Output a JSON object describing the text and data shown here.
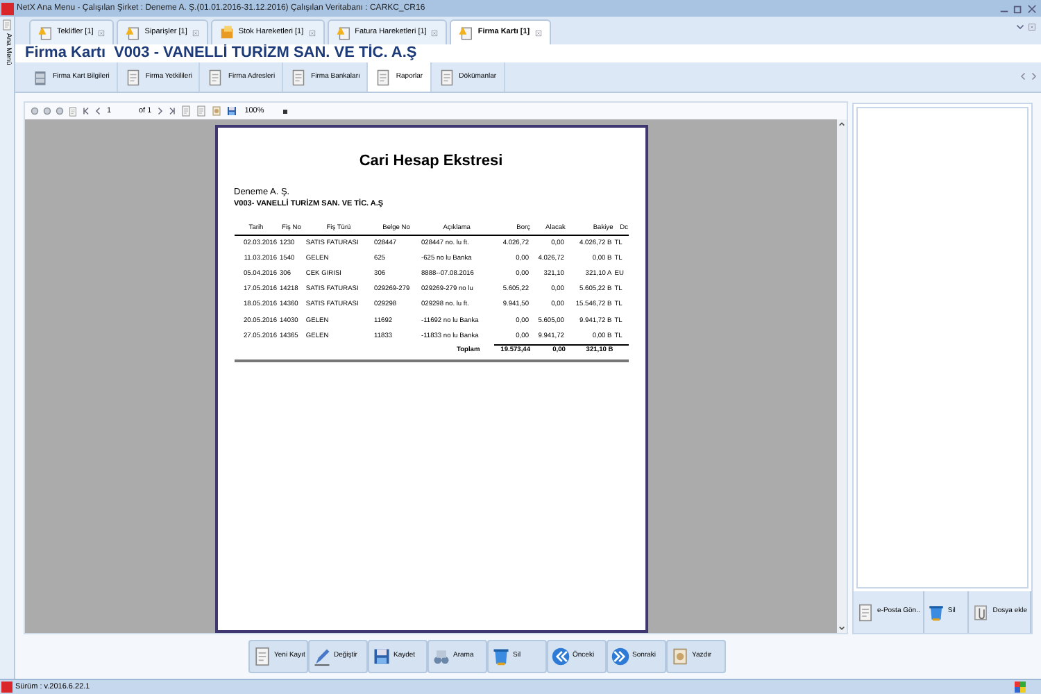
{
  "window": {
    "title": "NetX Ana Menu - Çalışılan Şirket : Deneme A. Ş.(01.01.2016-31.12.2016) Çalışılan Veritabanı : CARKC_CR16"
  },
  "side_menu": {
    "label": "Ana Menü"
  },
  "tabs": [
    {
      "label": "Teklifler [1]",
      "selected": false
    },
    {
      "label": "Siparişler [1]",
      "selected": false
    },
    {
      "label": "Stok Hareketleri [1]",
      "selected": false
    },
    {
      "label": "Fatura Hareketleri [1]",
      "selected": false
    },
    {
      "label": "Firma Kartı [1]",
      "selected": true
    }
  ],
  "heading": {
    "label": "Firma Kartı",
    "code": "V003 - VANELLİ TURİZM SAN. VE TİC. A.Ş"
  },
  "subtabs": [
    {
      "label": "Firma Kart Bilgileri",
      "selected": false
    },
    {
      "label": "Firma Yetkilileri",
      "selected": false
    },
    {
      "label": "Firma Adresleri",
      "selected": false
    },
    {
      "label": "Firma Bankaları",
      "selected": false
    },
    {
      "label": "Raporlar",
      "selected": true
    },
    {
      "label": "Dökümanlar",
      "selected": false
    }
  ],
  "viewer_toolbar": {
    "page": "1",
    "of_pages": "of 1",
    "zoom": "100%"
  },
  "report": {
    "title": "Cari Hesap Ekstresi",
    "company": "Deneme A. Ş.",
    "account": "V003- VANELLİ TURİZM SAN. VE TİC. A.Ş",
    "columns": [
      "Tarih",
      "Fiş No",
      "Fiş Türü",
      "Belge No",
      "Açıklama",
      "Borç",
      "Alacak",
      "Bakiye",
      "Dc"
    ],
    "rows": [
      [
        "02.03.2016",
        "1230",
        "SATIS FATURASI",
        "028447",
        "028447 no. lu ft.",
        "4.026,72",
        "0,00",
        "4.026,72 B",
        "TL"
      ],
      [
        "11.03.2016",
        "1540",
        "GELEN",
        "625",
        "-625 no lu Banka",
        "0,00",
        "4.026,72",
        "0,00 B",
        "TL"
      ],
      [
        "05.04.2016",
        "306",
        "CEK GIRISI",
        "306",
        "8888--07.08.2016",
        "0,00",
        "321,10",
        "321,10 A",
        "EU"
      ],
      [
        "17.05.2016",
        "14218",
        "SATIS FATURASI",
        "029269-279",
        "029269-279 no lu",
        "5.605,22",
        "0,00",
        "5.605,22 B",
        "TL"
      ],
      [
        "18.05.2016",
        "14360",
        "SATIS FATURASI",
        "029298",
        "029298 no. lu ft.",
        "9.941,50",
        "0,00",
        "15.546,72 B",
        "TL"
      ],
      [
        "20.05.2016",
        "14030",
        "GELEN",
        "11692",
        "-11692 no lu Banka",
        "0,00",
        "5.605,00",
        "9.941,72 B",
        "TL"
      ],
      [
        "27.05.2016",
        "14365",
        "GELEN",
        "11833",
        "-11833 no lu Banka",
        "0,00",
        "9.941,72",
        "0,00 B",
        "TL"
      ]
    ],
    "total": {
      "label": "Toplam",
      "borc": "19.573,44",
      "alacak": "0,00",
      "bakiye": "321,10 B"
    }
  },
  "side_buttons": [
    "e-Posta Gön..",
    "Sil",
    "Dosya ekle"
  ],
  "bottom_buttons": [
    "Yeni Kayıt",
    "Değiştir",
    "Kaydet",
    "Arama",
    "Sil",
    "Önceki",
    "Sonraki",
    "Yazdır"
  ],
  "status_bar": {
    "version": "Sürüm : v.2016.6.22.1"
  }
}
